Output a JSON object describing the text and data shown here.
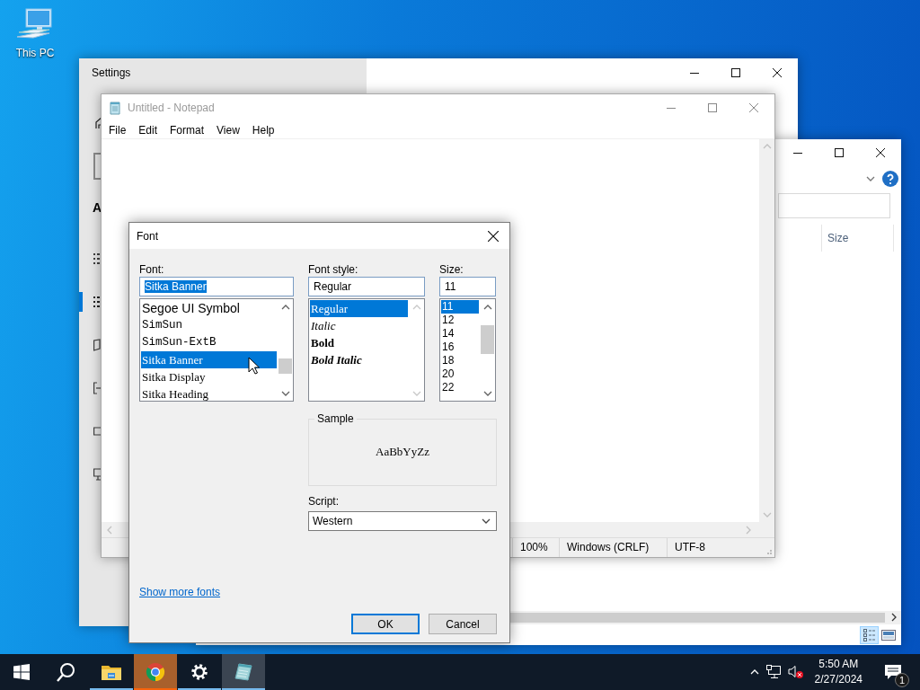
{
  "desktop_icons": [
    {
      "label": "This PC"
    }
  ],
  "settings_window": {
    "title": "Settings",
    "heading": "A",
    "nav_items": [
      {
        "kind": "dots",
        "selected": false
      },
      {
        "kind": "dots",
        "selected": true
      },
      {
        "kind": "book",
        "selected": false
      },
      {
        "kind": "arrow",
        "selected": false
      },
      {
        "kind": "frame",
        "selected": false
      },
      {
        "kind": "screen",
        "selected": false
      }
    ]
  },
  "explorer_window": {
    "column_header": "Size"
  },
  "notepad_window": {
    "title": "Untitled - Notepad",
    "active": false,
    "menu": [
      "File",
      "Edit",
      "Format",
      "View",
      "Help"
    ],
    "status_bar": [
      "100%",
      "Windows (CRLF)",
      "UTF-8"
    ]
  },
  "font_dialog": {
    "title": "Font",
    "font_label": "Font:",
    "font_field": {
      "value": "Sitka Banner",
      "highlighted": true
    },
    "fonts": [
      {
        "name": "Segoe UI Symbol",
        "kind": "sans",
        "selected": false
      },
      {
        "name": "SimSun",
        "kind": "mono",
        "selected": false
      },
      {
        "name": "SimSun-ExtB",
        "kind": "mono",
        "selected": false
      },
      {
        "name": "Sitka Banner",
        "kind": "serif",
        "selected": true
      },
      {
        "name": "Sitka Display",
        "kind": "serif",
        "selected": false
      },
      {
        "name": "Sitka Heading",
        "kind": "serif",
        "selected": false
      }
    ],
    "style_label": "Font style:",
    "style_field": {
      "value": "Regular"
    },
    "styles": [
      {
        "name": "Regular",
        "kind": "regular",
        "selected": true
      },
      {
        "name": "Italic",
        "kind": "italic",
        "selected": false
      },
      {
        "name": "Bold",
        "kind": "bold",
        "selected": false
      },
      {
        "name": "Bold Italic",
        "kind": "bold-italic",
        "selected": false
      }
    ],
    "size_label": "Size:",
    "size_field": {
      "value": "11"
    },
    "sizes": [
      {
        "name": "11",
        "selected": true
      },
      {
        "name": "12",
        "selected": false
      },
      {
        "name": "14",
        "selected": false
      },
      {
        "name": "16",
        "selected": false
      },
      {
        "name": "18",
        "selected": false
      },
      {
        "name": "20",
        "selected": false
      },
      {
        "name": "22",
        "selected": false
      }
    ],
    "sample_label": "Sample",
    "sample_text": "AaBbYyZz",
    "script_label": "Script:",
    "script_value": "Western",
    "more_fonts_link": "Show more fonts",
    "buttons": [
      {
        "label": "OK",
        "kind": "default"
      },
      {
        "label": "Cancel",
        "kind": "normal"
      }
    ]
  },
  "taskbar": {
    "apps": [
      {
        "kind": "start",
        "running": false,
        "flashing": false,
        "active": false
      },
      {
        "kind": "search",
        "running": false,
        "flashing": false,
        "active": false
      },
      {
        "kind": "explorer",
        "running": true,
        "flashing": false,
        "active": false
      },
      {
        "kind": "chrome",
        "running": true,
        "flashing": true,
        "active": false
      },
      {
        "kind": "settings",
        "running": true,
        "flashing": false,
        "active": false
      },
      {
        "kind": "notepad",
        "running": true,
        "flashing": false,
        "active": true
      }
    ],
    "tray": [
      {
        "kind": "chevron"
      },
      {
        "kind": "network"
      },
      {
        "kind": "volume",
        "muted": true
      }
    ],
    "clock": {
      "time": "5:50 AM",
      "date": "2/27/2024"
    },
    "notifications": {
      "count": "1"
    }
  }
}
